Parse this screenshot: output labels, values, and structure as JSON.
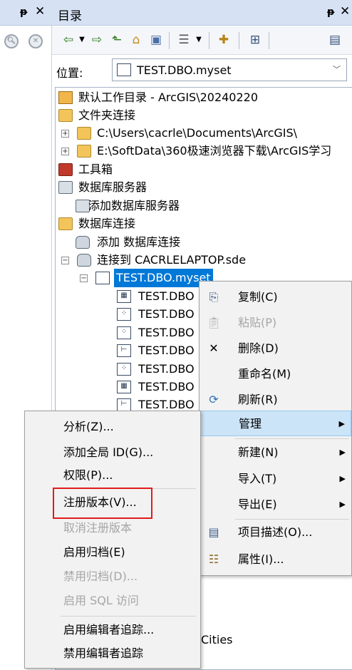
{
  "catalog": {
    "title": "目录",
    "pin_glyph": "ᵽ",
    "close_glyph": "✕",
    "location_label": "位置:",
    "location_value": "TEST.DBO.myset"
  },
  "tree": {
    "home_folder": "默认工作目录 - ArcGIS\\20240220",
    "folder_connections": "文件夹连接",
    "folder_1": "C:\\Users\\cacrle\\Documents\\ArcGIS\\",
    "folder_2": "E:\\SoftData\\360极速浏览器下载\\ArcGIS学习",
    "toolboxes": "工具箱",
    "db_servers": "数据库服务器",
    "add_db_server": "添加数据库服务器",
    "db_connections": "数据库连接",
    "add_db_connection": "添加 数据库连接",
    "sde_connection": "连接到 CACRLELAPTOP.sde",
    "selected_dataset": "TEST.DBO.myset",
    "children": [
      "TEST.DBO",
      "TEST.DBO",
      "TEST.DBO",
      "TEST.DBO",
      "TEST.DBO",
      "TEST.DBO",
      "TEST.DBO"
    ],
    "cities": "Cities"
  },
  "context_menu": {
    "copy": "复制(C)",
    "paste": "粘贴(P)",
    "delete": "删除(D)",
    "rename": "重命名(M)",
    "refresh": "刷新(R)",
    "manage": "管理",
    "new": "新建(N)",
    "import": "导入(T)",
    "export": "导出(E)",
    "item_description": "项目描述(O)...",
    "properties": "属性(I)..."
  },
  "manage_submenu": {
    "analyze": "分析(Z)...",
    "add_global_id": "添加全局 ID(G)...",
    "privileges": "权限(P)...",
    "register_versioned": "注册版本(V)...",
    "unregister_versioned": "取消注册版本",
    "enable_archiving": "启用归档(E)",
    "disable_archiving": "禁用归档(D)...",
    "enable_sql_access": "启用 SQL 访问",
    "enable_editor_tracking": "启用编辑者追踪...",
    "disable_editor_tracking": "禁用编辑者追踪"
  },
  "colors": {
    "selection": "#0078d7",
    "menu_highlight": "#cce4f7",
    "annotation_box": "#e21b1b",
    "title_bar": "#d6e2f4"
  },
  "icons": {
    "toolbar": [
      "back-arrow-icon",
      "dropdown-icon",
      "forward-arrow-icon",
      "up-level-icon",
      "home-icon",
      "connect-folder-icon",
      "view-options-icon",
      "view-dropdown-icon",
      "new-item-icon",
      "tree-toggle-icon",
      "contents-icon"
    ]
  }
}
